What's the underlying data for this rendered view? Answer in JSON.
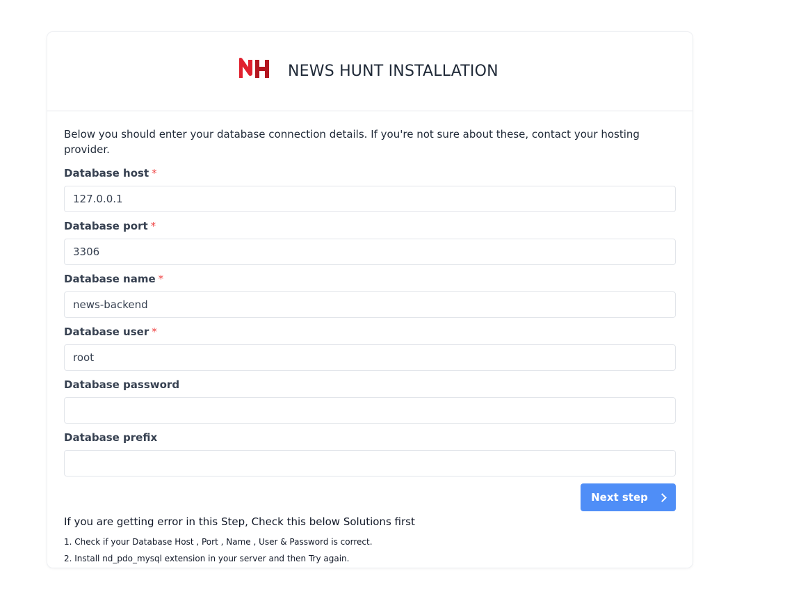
{
  "header": {
    "title": "NEWS HUNT INSTALLATION",
    "logo_icon": "nh-logo-icon",
    "logo_colors": [
      "#e0202e",
      "#b3151f"
    ]
  },
  "intro": "Below you should enter your database connection details. If you're not sure about these, contact your hosting provider.",
  "required_mark": "*",
  "fields": [
    {
      "label": "Database host",
      "value": "127.0.0.1",
      "required": true
    },
    {
      "label": "Database port",
      "value": "3306",
      "required": true
    },
    {
      "label": "Database name",
      "value": "news-backend",
      "required": true
    },
    {
      "label": "Database user",
      "value": "root",
      "required": true
    },
    {
      "label": "Database password",
      "value": "",
      "required": false
    },
    {
      "label": "Database prefix",
      "value": "",
      "required": false
    }
  ],
  "next_button": {
    "label": "Next step",
    "icon": "chevron-right-icon",
    "color": "#4f8ef7"
  },
  "help": {
    "title": "If you are getting error in this Step, Check this below Solutions first",
    "items": [
      "1. Check if your Database Host , Port , Name , User & Password is correct.",
      "2. Install nd_pdo_mysql extension in your server and then Try again."
    ]
  }
}
